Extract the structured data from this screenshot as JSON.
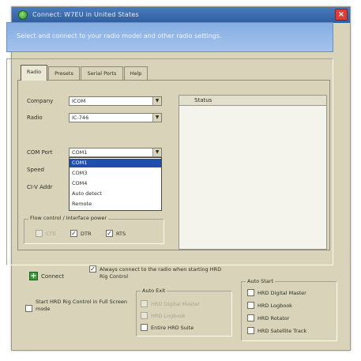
{
  "window": {
    "title": "Connect:  W7EU in United States",
    "close_glyph": "×"
  },
  "banner": {
    "text": "Select and connect to your radio model and other radio settings."
  },
  "tabs": [
    {
      "label": "Radio",
      "active": true
    },
    {
      "label": "Presets",
      "active": false
    },
    {
      "label": "Serial Ports",
      "active": false
    },
    {
      "label": "Help",
      "active": false
    }
  ],
  "radio_tab": {
    "company_label": "Company",
    "company_value": "ICOM",
    "radio_label": "Radio",
    "radio_value": "IC-746",
    "com_port_label": "COM Port",
    "com_port_value": "COM1",
    "speed_label": "Speed",
    "civ_label": "CI-V Addr",
    "com_port_options": [
      "COM1",
      "COM3",
      "COM4",
      "Auto detect",
      "Remote"
    ],
    "com_port_selected_index": 0,
    "flow_control_label": "Flow control / Interface power",
    "cts_label": "CTS",
    "cts_checked": false,
    "dtr_label": "DTR",
    "dtr_checked": true,
    "rts_label": "RTS",
    "rts_checked": true
  },
  "status": {
    "title": "Status"
  },
  "bottom": {
    "connect_label": "Connect",
    "always_connect_label": "Always connect to the radio when starting HRD Rig Control",
    "always_connect_checked": true,
    "start_fullscreen_label": "Start HRD Rig Control in Full Screen mode",
    "start_fullscreen_checked": false,
    "auto_exit_label": "Auto Exit",
    "auto_exit_items": [
      {
        "label": "HRD Digital Master",
        "checked": false,
        "disabled": true
      },
      {
        "label": "HRD Logbook",
        "checked": false,
        "disabled": true
      },
      {
        "label": "Entire HRD Suite",
        "checked": false,
        "disabled": false
      }
    ],
    "auto_start_label": "Auto Start",
    "auto_start_items": [
      {
        "label": "HRD Digital Master",
        "checked": false
      },
      {
        "label": "HRD Logbook",
        "checked": false
      },
      {
        "label": "HRD Rotator",
        "checked": false
      },
      {
        "label": "HRD Satellite Track",
        "checked": false
      }
    ]
  },
  "colors": {
    "titlebar": "#2f5e9e",
    "banner": "#86aee2",
    "dialog_bg": "#d9d4b9",
    "selection": "#1f4fa8",
    "close_button": "#d8403b",
    "connect_icon": "#3a9b36"
  },
  "icons": {
    "app": "app-icon",
    "close": "close-icon",
    "connect": "plus-icon",
    "dropdown": "chevron-down-icon"
  }
}
